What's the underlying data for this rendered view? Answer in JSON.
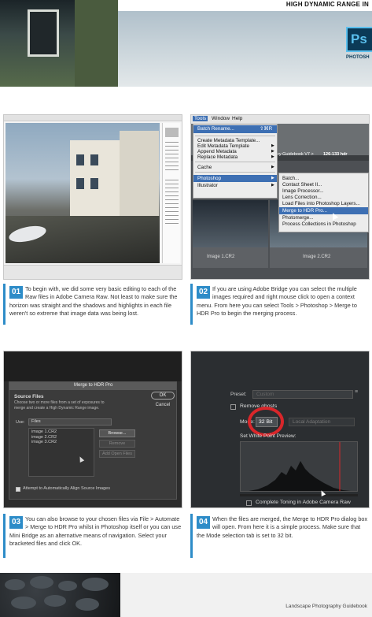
{
  "header": {
    "title": "HIGH DYNAMIC RANGE IN",
    "badge": "Ps",
    "badge_label": "PHOTOSH"
  },
  "step1": {
    "num": "01",
    "text": "To begin with, we did some very basic editing to each of the Raw files in Adobe Camera Raw. Not least to make sure the horizon was straight and the shadows and highlights in each file weren't so extreme that image data was being lost."
  },
  "step2": {
    "num": "02",
    "text": "If you are using Adobe Bridge you can select the multiple images required and right mouse click to open a context menu. From here you can select Tools > Photoshop > Merge to HDR Pro to begin the merging process."
  },
  "step3": {
    "num": "03",
    "text": "You can also browse to your chosen files via File > Automate > Merge to HDR Pro whilst in Photoshop itself or you can use Mini Bridge as an alternative means of navigation. Select your bracketed files and click OK."
  },
  "step4": {
    "num": "04",
    "text": "When the files are merged, the Merge to HDR Pro dialog box will open. From here it is a simple process. Make sure that the Mode selection tab is set to 32 bit."
  },
  "menu": {
    "bar": [
      "Tools",
      "Window",
      "Help"
    ],
    "items": [
      {
        "label": "Batch Rename...",
        "shortcut": "⇧⌘R"
      },
      {
        "label": "Create Metadata Template..."
      },
      {
        "label": "Edit Metadata Template",
        "arrow": "▶"
      },
      {
        "label": "Append Metadata",
        "arrow": "▶"
      },
      {
        "label": "Replace Metadata",
        "arrow": "▶"
      },
      {
        "label": "Cache",
        "arrow": "▶"
      },
      {
        "label": "Photoshop",
        "arrow": "▶"
      },
      {
        "label": "Illustrator",
        "arrow": "▶"
      }
    ],
    "submenu": [
      "Batch...",
      "Contact Sheet II...",
      "Image Processor...",
      "Lens Correction...",
      "Load Files into Photoshop Layers...",
      "Merge to HDR Pro...",
      "Photomerge...",
      "Process Collections in Photoshop"
    ],
    "path": "ry Guidebook V7 >",
    "folder": "126-133 hdr",
    "thumbs": [
      "Image 1.CR2",
      "Image 2.CR2"
    ]
  },
  "dialog": {
    "title": "Merge to HDR Pro",
    "source_heading": "Source Files",
    "source_desc": "Choose two or more files from a set of exposures to merge and create a High Dynamic Range image.",
    "use_label": "Use:",
    "use_value": "Files",
    "files": [
      "image 1.CR2",
      "image 2.CR2",
      "image 3.CR2"
    ],
    "ok": "OK",
    "cancel": "Cancel",
    "browse": "Browse...",
    "remove": "Remove",
    "add_open": "Add Open Files",
    "align": "Attempt to Automatically Align Source Images"
  },
  "hdr": {
    "preset_label": "Preset:",
    "preset_value": "Custom",
    "remove_ghosts": "Remove ghosts",
    "mode_label": "Mode:",
    "mode_value": "32 Bit",
    "mode_option": "Local Adaptation",
    "white_point": "Set White Point Preview:",
    "toning": "Complete Toning in Adobe Camera Raw"
  },
  "footer": {
    "text": "Landscape Photography Guidebook"
  },
  "colors": {
    "accent": "#2d8cc8",
    "dark_ui": "#2c2c2c",
    "highlight": "#3d6fb3",
    "ring": "#d9262a"
  }
}
